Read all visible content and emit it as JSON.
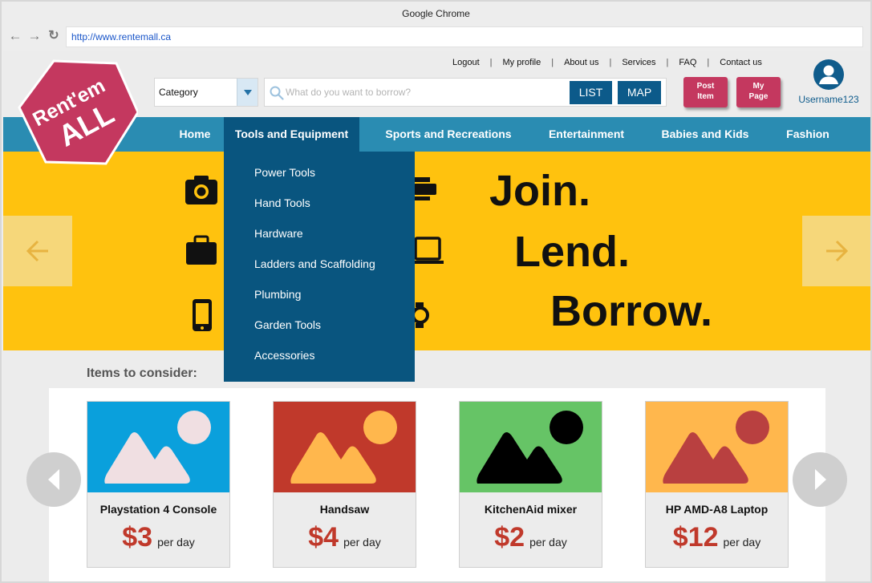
{
  "browser": {
    "title": "Google Chrome",
    "url": "http://www.rentemall.ca"
  },
  "top_links": [
    "Logout",
    "My profile",
    "About us",
    "Services",
    "FAQ",
    "Contact us"
  ],
  "logo": {
    "line1": "Rent'em",
    "line2": "ALL",
    "color": "#c4385f"
  },
  "search": {
    "category_label": "Category",
    "placeholder": "What do you want to borrow?",
    "list_label": "LIST",
    "map_label": "MAP"
  },
  "actions": {
    "post_item": [
      "Post",
      "Item"
    ],
    "my_page": [
      "My",
      "Page"
    ]
  },
  "user": {
    "username": "Username123"
  },
  "nav": {
    "items": [
      "Home",
      "Tools and Equipment",
      "Sports and Recreations",
      "Entertainment",
      "Babies and Kids",
      "Fashion"
    ],
    "active": "Tools and Equipment"
  },
  "dropdown": {
    "items": [
      "Power Tools",
      "Hand Tools",
      "Hardware",
      "Ladders and Scaffolding",
      "Plumbing",
      "Garden Tools",
      "Accessories"
    ]
  },
  "hero": {
    "lines": [
      "Join.",
      "Lend.",
      "Borrow."
    ],
    "icons": [
      "camera-icon",
      "printer-icon",
      "briefcase-icon",
      "laptop-icon",
      "phone-icon",
      "watch-icon"
    ],
    "color": "#ffc20e"
  },
  "items_section": {
    "title": "Items to consider:",
    "items": [
      {
        "name": "Playstation 4 Console",
        "price": "$3",
        "unit": "per day",
        "bg": "#0aa0dc",
        "fg": "#f0dfe2"
      },
      {
        "name": "Handsaw",
        "price": "$4",
        "unit": "per day",
        "bg": "#c0392b",
        "fg": "#ffb74d"
      },
      {
        "name": "KitchenAid mixer",
        "price": "$2",
        "unit": "per day",
        "bg": "#66c466",
        "fg": "#000000"
      },
      {
        "name": "HP AMD-A8 Laptop",
        "price": "$12",
        "unit": "per day",
        "bg": "#ffb74d",
        "fg": "#b94040"
      }
    ]
  }
}
